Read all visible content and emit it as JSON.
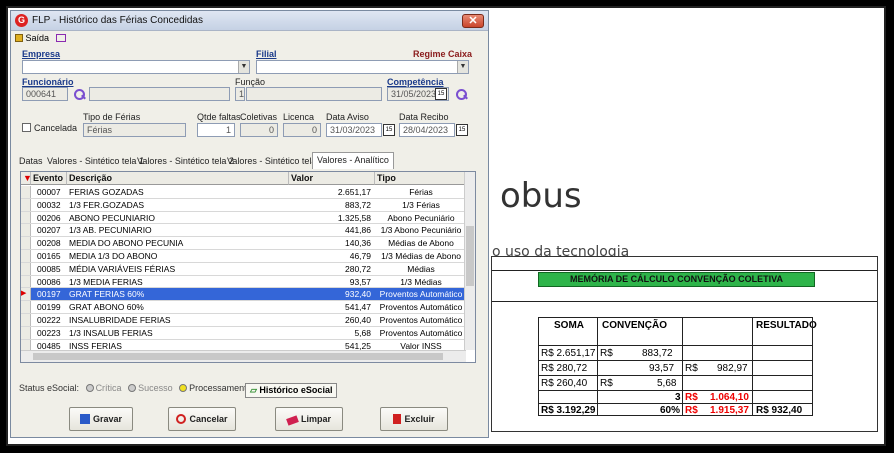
{
  "background": {
    "word": "obus",
    "subtitle": "o uso da tecnologia"
  },
  "sheet": {
    "banner": "MEMÓRIA DE CÁLCULO CONVENÇÃO COLETIVA",
    "headers": {
      "soma": "SOMA",
      "convencao": "CONVENÇÃO",
      "resultado": "RESULTADO"
    },
    "rows": [
      {
        "a": "R$ 2.651,17",
        "b": "R$",
        "c": "883,72",
        "d": "",
        "e": "",
        "f": ""
      },
      {
        "a": "R$   280,72",
        "b": "",
        "c": "93,57",
        "d": "R$",
        "e": "982,97",
        "f": ""
      },
      {
        "a": "R$   260,40",
        "b": "R$",
        "c": "5,68",
        "d": "",
        "e": "",
        "f": ""
      },
      {
        "a": "",
        "b": "",
        "c": "3",
        "d": "R$",
        "e": "1.064,10",
        "f": ""
      },
      {
        "a": "R$ 3.192,29",
        "b": "",
        "c": "60%",
        "d": "R$",
        "e": "1.915,37",
        "f": "R$    932,40"
      }
    ]
  },
  "window": {
    "title": "FLP - Histórico das Férias Concedidas",
    "close": "✕",
    "menu": {
      "saida": "Saída"
    },
    "labels": {
      "empresa": "Empresa",
      "filial": "Filial",
      "regime": "Regime Caixa",
      "funcionario": "Funcionário",
      "funcao": "Função",
      "competencia": "Competência",
      "cancelada": "Cancelada",
      "tipo_ferias": "Tipo de Férias",
      "qtde_faltas": "Qtde faltas",
      "coletivas": "Coletivas",
      "licenca": "Licenca",
      "data_aviso": "Data Aviso",
      "data_recibo": "Data Recibo"
    },
    "values": {
      "funcionario": "000641",
      "funcao": "1",
      "competencia": "31/05/2023",
      "tipo_ferias": "Férias",
      "qtde_faltas": "1",
      "coletivas": "0",
      "licenca": "0",
      "data_aviso": "31/03/2023",
      "data_recibo": "28/04/2023"
    },
    "tabs": [
      "Datas",
      "Valores - Sintético tela 1",
      "Valores - Sintético tela 2",
      "Valores - Sintético tela 3",
      "Valores - Analítico"
    ],
    "grid": {
      "columns": [
        "Evento",
        "Descrição",
        "Valor",
        "Tipo"
      ],
      "rows": [
        [
          "00007",
          "FERIAS GOZADAS",
          "2.651,17",
          "Férias"
        ],
        [
          "00032",
          "1/3 FER.GOZADAS",
          "883,72",
          "1/3 Férias"
        ],
        [
          "00206",
          "ABONO PECUNIARIO",
          "1.325,58",
          "Abono Pecuniário"
        ],
        [
          "00207",
          "1/3 AB. PECUNIARIO",
          "441,86",
          "1/3 Abono Pecuniário"
        ],
        [
          "00208",
          "MEDIA DO ABONO PECUNIA",
          "140,36",
          "Médias de Abono"
        ],
        [
          "00165",
          "MEDIA 1/3 DO ABONO",
          "46,79",
          "1/3 Médias de Abono"
        ],
        [
          "00085",
          "MÉDIA VARIÁVEIS FÉRIAS",
          "280,72",
          "Médias"
        ],
        [
          "00086",
          "1/3 MEDIA FERIAS",
          "93,57",
          "1/3 Médias"
        ],
        [
          "00197",
          "GRAT FERIAS 60%",
          "932,40",
          "Proventos Automático"
        ],
        [
          "00199",
          "GRAT ABONO 60%",
          "541,47",
          "Proventos Automático"
        ],
        [
          "00222",
          "INSALUBRIDADE FERIAS",
          "260,40",
          "Proventos Automático"
        ],
        [
          "00223",
          "1/3 INSALUB FERIAS",
          "5,68",
          "Proventos Automático"
        ],
        [
          "00485",
          "INSS FERIAS",
          "541,25",
          "Valor INSS"
        ]
      ]
    },
    "status": {
      "label": "Status eSocial:",
      "critica": "Crítica",
      "sucesso": "Sucesso",
      "processamento": "Processamento",
      "historico": "Histórico eSocial"
    },
    "buttons": {
      "gravar": "Gravar",
      "cancelar": "Cancelar",
      "limpar": "Limpar",
      "excluir": "Excluir"
    },
    "colors": {
      "selected_row": "#3466d8",
      "banner": "#2eb44a"
    }
  }
}
